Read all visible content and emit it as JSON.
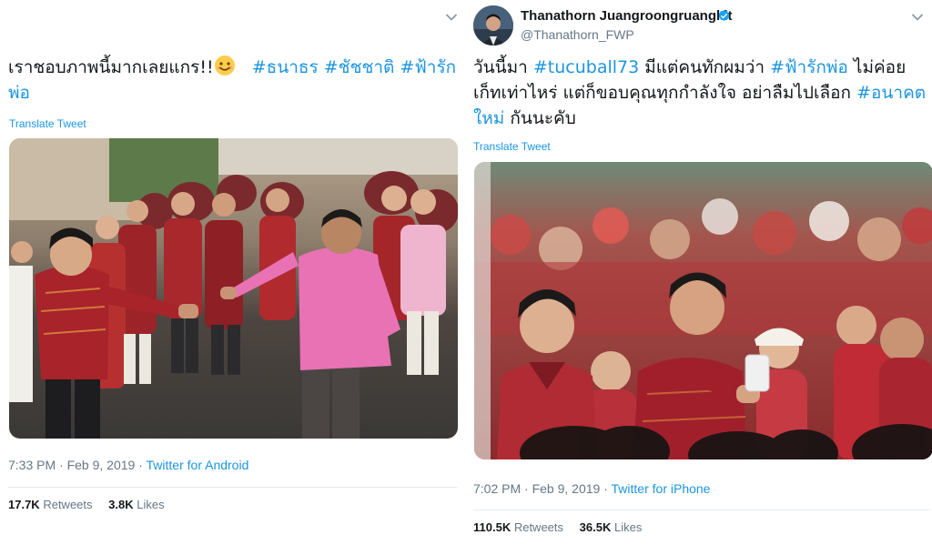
{
  "left_tweet": {
    "text_plain": "เราชอบภาพนี้มากเลยแกร!!",
    "emoji": "smiling-face-emoji",
    "hashtags": [
      "#ธนาธร",
      "#ชัชชาติ",
      "#ฟ้ารัก",
      "พ่อ"
    ],
    "translate_label": "Translate Tweet",
    "time": "7:33 PM",
    "date": "Feb 9, 2019",
    "separator": "·",
    "source": "Twitter for Android",
    "retweets_count": "17.7K",
    "retweets_label": "Retweets",
    "likes_count": "3.8K",
    "likes_label": "Likes",
    "menu_icon": "chevron-down-icon"
  },
  "right_tweet": {
    "author_name": "Thanathorn Juangroongruangkit",
    "author_handle": "@Thanathorn_FWP",
    "verified_icon": "verified-badge-icon",
    "text": {
      "part1": "วันนี้มา ",
      "tag1": "#tucuball73",
      "part2": " มีแต่คนทักผมว่า ",
      "tag2": "#ฟ้ารักพ่อ",
      "part3": " ไม่ค่อยเก็ทเท่าไหร่ แต่ก็ขอบคุณทุกกำลังใจ อย่าลืมไปเลือก ",
      "tag3": "#อนาคตใหม่",
      "part4": " กันนะคับ"
    },
    "translate_label": "Translate Tweet",
    "time": "7:02 PM",
    "date": "Feb 9, 2019",
    "separator": "·",
    "source": "Twitter for iPhone",
    "retweets_count": "110.5K",
    "retweets_label": "Retweets",
    "likes_count": "36.5K",
    "likes_label": "Likes",
    "menu_icon": "chevron-down-icon"
  },
  "colors": {
    "link": "#1b95e0",
    "text": "#14171a",
    "muted": "#657786",
    "divider": "#e6ecf0",
    "jersey_red": "#b3262a",
    "shirt_pink": "#e872b4"
  }
}
